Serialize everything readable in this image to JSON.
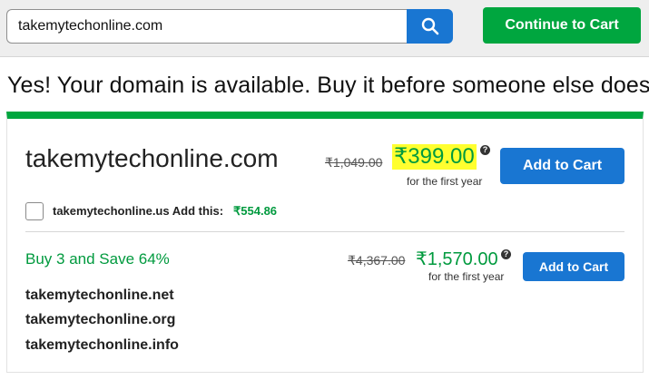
{
  "search": {
    "value": "takemytechonline.com",
    "button_icon": "search-icon"
  },
  "header": {
    "continue_label": "Continue to Cart"
  },
  "headline": "Yes! Your domain is available. Buy it before someone else does.",
  "colors": {
    "accent_green": "#00a63f",
    "primary_blue": "#1976d2",
    "price_highlight": "#ffff2f"
  },
  "main_offer": {
    "domain": "takemytechonline.com",
    "old_price": "₹1,049.00",
    "price": "₹399.00",
    "info_icon": "?",
    "period": "for the first year",
    "add_label": "Add to Cart"
  },
  "addon": {
    "checked": false,
    "domain": "takemytechonline.us",
    "add_this_label": "Add this:",
    "price": "₹554.86"
  },
  "bundle": {
    "title": "Buy 3 and Save 64%",
    "old_price": "₹4,367.00",
    "price": "₹1,570.00",
    "info_icon": "?",
    "period": "for the first year",
    "add_label": "Add to Cart",
    "domains": [
      "takemytechonline.net",
      "takemytechonline.org",
      "takemytechonline.info"
    ]
  }
}
